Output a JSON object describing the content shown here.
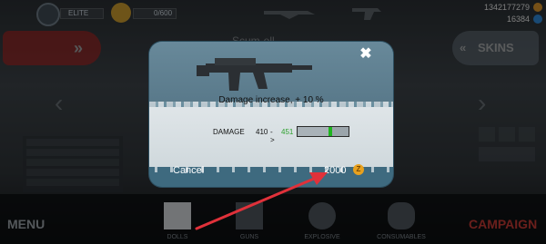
{
  "topbar": {
    "rank_badge": "ELITE",
    "xp_text": "0/600",
    "currency_primary": "1342177279",
    "currency_secondary": "16384"
  },
  "hud": {
    "weapon_name": "Scum-ell",
    "skins_label": "SKINS",
    "menu_label": "MENU",
    "campaign_label": "CAMPAIGN",
    "categories": [
      "DOLLS",
      "GUNS",
      "EXPLOSIVE",
      "CONSUMABLES"
    ]
  },
  "modal": {
    "description": "Damage increase, + 10 %",
    "damage_label": "DAMAGE",
    "damage_old": "410",
    "damage_arrow": "->",
    "damage_new": "451",
    "damage_base_fraction": 0.6,
    "damage_increase_fraction": 0.08,
    "cancel_label": "Cancel",
    "price": "2000",
    "coin_symbol": "Z",
    "close_symbol": "✖"
  },
  "colors": {
    "modal_bg": "#3e6a7f",
    "upgrade_green": "#1fb51f",
    "coin": "#e8a11e",
    "annotation_arrow": "#e0313a"
  },
  "icons": [
    "close-icon",
    "coin-icon",
    "gun-icon",
    "arrow-up-icon",
    "grenade-icon",
    "gas-mask-icon",
    "annotation-arrow"
  ]
}
